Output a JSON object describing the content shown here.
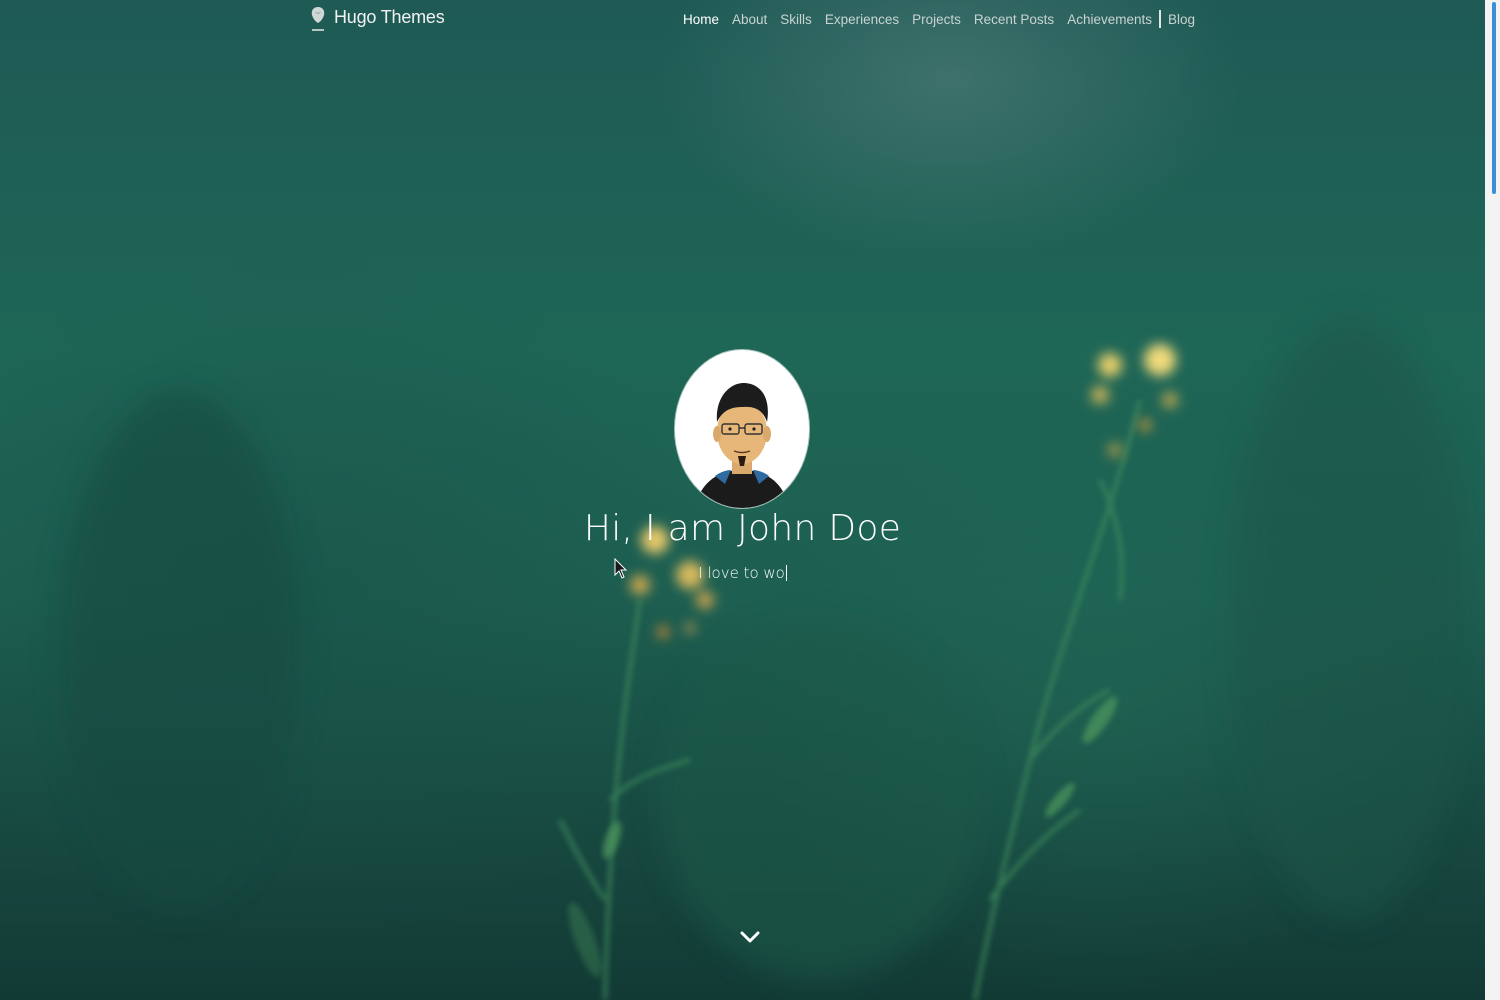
{
  "brand": {
    "name": "Hugo Themes",
    "logo_icon": "hugo-logo-icon"
  },
  "nav": {
    "items": [
      {
        "label": "Home",
        "active": true
      },
      {
        "label": "About"
      },
      {
        "label": "Skills"
      },
      {
        "label": "Experiences"
      },
      {
        "label": "Projects"
      },
      {
        "label": "Recent Posts"
      },
      {
        "label": "Achievements"
      }
    ],
    "blog_label": "Blog"
  },
  "hero": {
    "title": "Hi, I am John Doe",
    "subtitle": "I love to wo",
    "scroll_icon": "chevron-down-icon"
  },
  "colors": {
    "background": "#1e6656",
    "text": "#ffffff",
    "nav_text": "#c9d4d2",
    "scrollbar_thumb": "#3a8fd6"
  }
}
